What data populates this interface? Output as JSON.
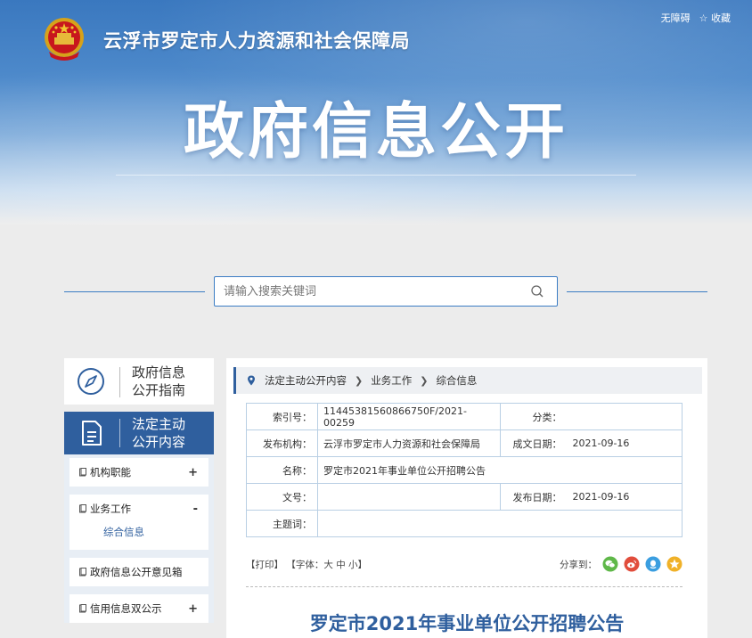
{
  "header": {
    "org_name": "云浮市罗定市人力资源和社会保障局",
    "banner_title": "政府信息公开",
    "links": {
      "accessibility": "无障碍",
      "favorite": "☆ 收藏"
    }
  },
  "search": {
    "placeholder": "请输入搜索关键词"
  },
  "sidebar": {
    "guide": {
      "line1": "政府信息",
      "line2": "公开指南"
    },
    "active": {
      "line1": "法定主动",
      "line2": "公开内容"
    },
    "items": [
      {
        "label": "机构职能",
        "toggle": "+"
      },
      {
        "label": "业务工作",
        "toggle": "-",
        "sub": "综合信息"
      },
      {
        "label": "政府信息公开意见箱",
        "toggle": ""
      },
      {
        "label": "信用信息双公示",
        "toggle": "+"
      }
    ]
  },
  "breadcrumb": [
    "法定主动公开内容",
    "业务工作",
    "综合信息"
  ],
  "meta": {
    "index_label": "索引号：",
    "index_value": "11445381560866750F/2021-00259",
    "category_label": "分类：",
    "category_value": "",
    "issuer_label": "发布机构：",
    "issuer_value": "云浮市罗定市人力资源和社会保障局",
    "created_label": "成文日期：",
    "created_value": "2021-09-16",
    "name_label": "名称：",
    "name_value": "罗定市2021年事业单位公开招聘公告",
    "docno_label": "文号：",
    "docno_value": "",
    "published_label": "发布日期：",
    "published_value": "2021-09-16",
    "keywords_label": "主题词：",
    "keywords_value": ""
  },
  "tools": {
    "print": "【打印】",
    "font_prefix": "【字体：",
    "font_large": "大",
    "font_medium": "中",
    "font_small": "小",
    "font_suffix": "】",
    "share_label": "分享到："
  },
  "colors": {
    "primary": "#2f5f9e",
    "accent_line": "#3b7cc4",
    "wechat": "#5fb849",
    "weibo": "#e14d3c",
    "qq": "#3a9ee0",
    "qzone": "#f0b128"
  },
  "article": {
    "title": "罗定市2021年事业单位公开招聘公告"
  }
}
